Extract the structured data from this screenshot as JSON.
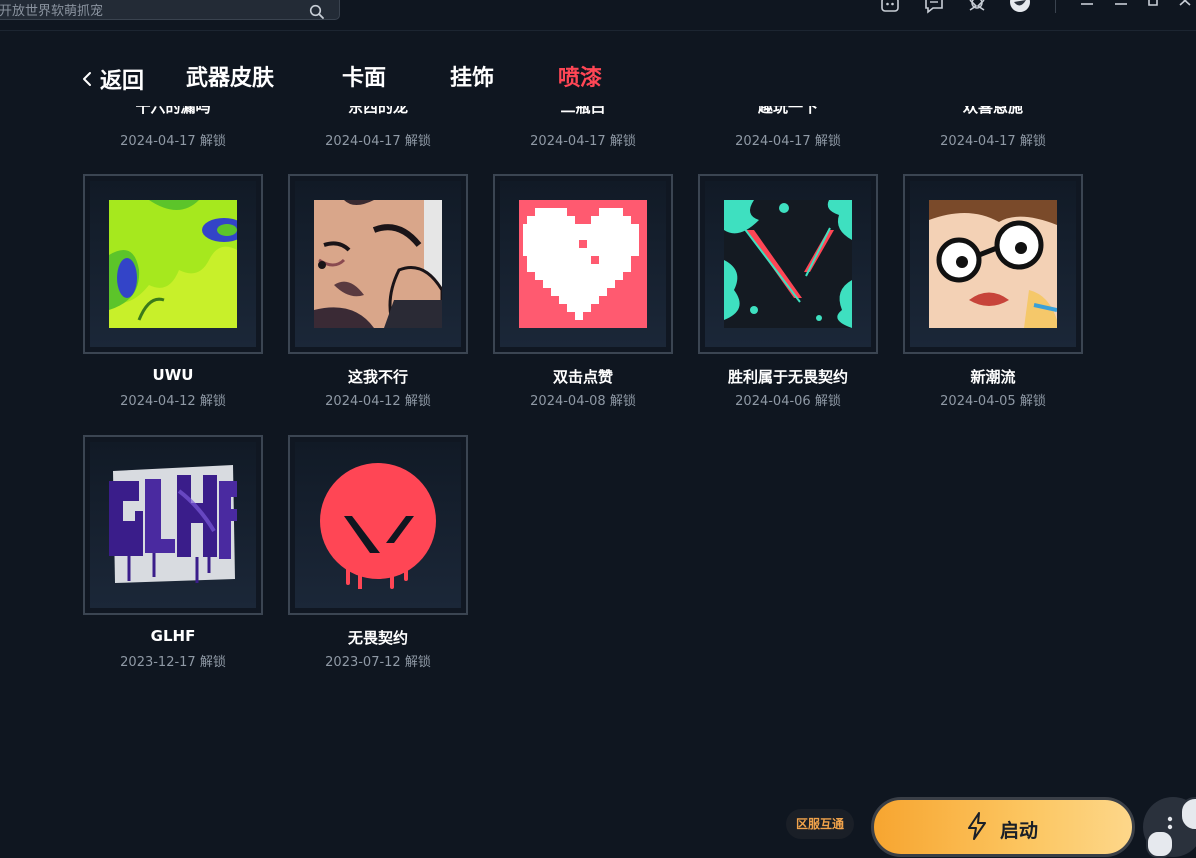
{
  "topbar": {
    "search_placeholder": "开放世界软萌抓宠",
    "icons": [
      "robot-icon",
      "message-icon",
      "arrows-icon",
      "avatar-icon",
      "menu-icon",
      "minimize-icon",
      "restore-icon",
      "close-icon"
    ]
  },
  "nav": {
    "back_label": "返回",
    "tabs": [
      {
        "label": "武器皮肤",
        "active": false
      },
      {
        "label": "卡面",
        "active": false
      },
      {
        "label": "挂饰",
        "active": false
      },
      {
        "label": "喷漆",
        "active": true
      }
    ],
    "accent_color": "#ff4655"
  },
  "unlock_suffix": "解锁",
  "top_row_partial": [
    {
      "name": "十六的漏吗",
      "date": "2024-04-17 解锁"
    },
    {
      "name": "东西的龙",
      "date": "2024-04-17 解锁"
    },
    {
      "name": "二瓶白",
      "date": "2024-04-17 解锁"
    },
    {
      "name": "趣玩一下",
      "date": "2024-04-17 解锁"
    },
    {
      "name": "欢喜恩施",
      "date": "2024-04-17 解锁"
    }
  ],
  "sprays": [
    {
      "name": "UWU",
      "date": "2024-04-12 解锁",
      "art": "green-blob"
    },
    {
      "name": "这我不行",
      "date": "2024-04-12 解锁",
      "art": "agent-face"
    },
    {
      "name": "双击点赞",
      "date": "2024-04-08 解锁",
      "art": "pixel-heart"
    },
    {
      "name": "胜利属于无畏契约",
      "date": "2024-04-06 解锁",
      "art": "valorant-teal"
    },
    {
      "name": "新潮流",
      "date": "2024-04-05 解锁",
      "art": "glasses-face"
    },
    {
      "name": "GLHF",
      "date": "2023-12-17 解锁",
      "art": "glhf-graffiti"
    },
    {
      "name": "无畏契约",
      "date": "2023-07-12 解锁",
      "art": "valorant-logo"
    }
  ],
  "bottom": {
    "region_label": "区服互通",
    "launch_label": "启动",
    "launch_gradient": [
      "#f7a530",
      "#fdd78a"
    ]
  }
}
